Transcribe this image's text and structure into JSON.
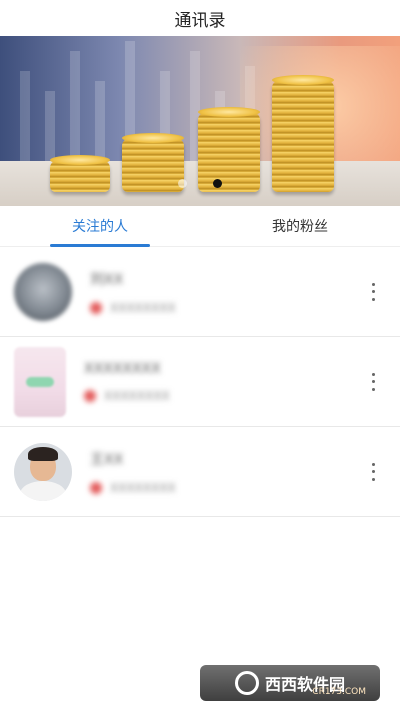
{
  "header": {
    "title": "通讯录"
  },
  "tabs": [
    {
      "label": "关注的人",
      "active": true
    },
    {
      "label": "我的粉丝",
      "active": false
    }
  ],
  "carousel": {
    "total": 2,
    "active_index": 1
  },
  "contacts": [
    {
      "name": "刘XX",
      "subtitle": "XXXXXXXX"
    },
    {
      "name": "XXXXXXXX",
      "subtitle": "XXXXXXXX"
    },
    {
      "name": "王XX",
      "subtitle": "XXXXXXXX"
    }
  ],
  "watermark": {
    "text": "西西软件园",
    "sub": "CR173.COM"
  },
  "colors": {
    "accent": "#2a7bd4",
    "status_dot": "#e35b5b"
  }
}
